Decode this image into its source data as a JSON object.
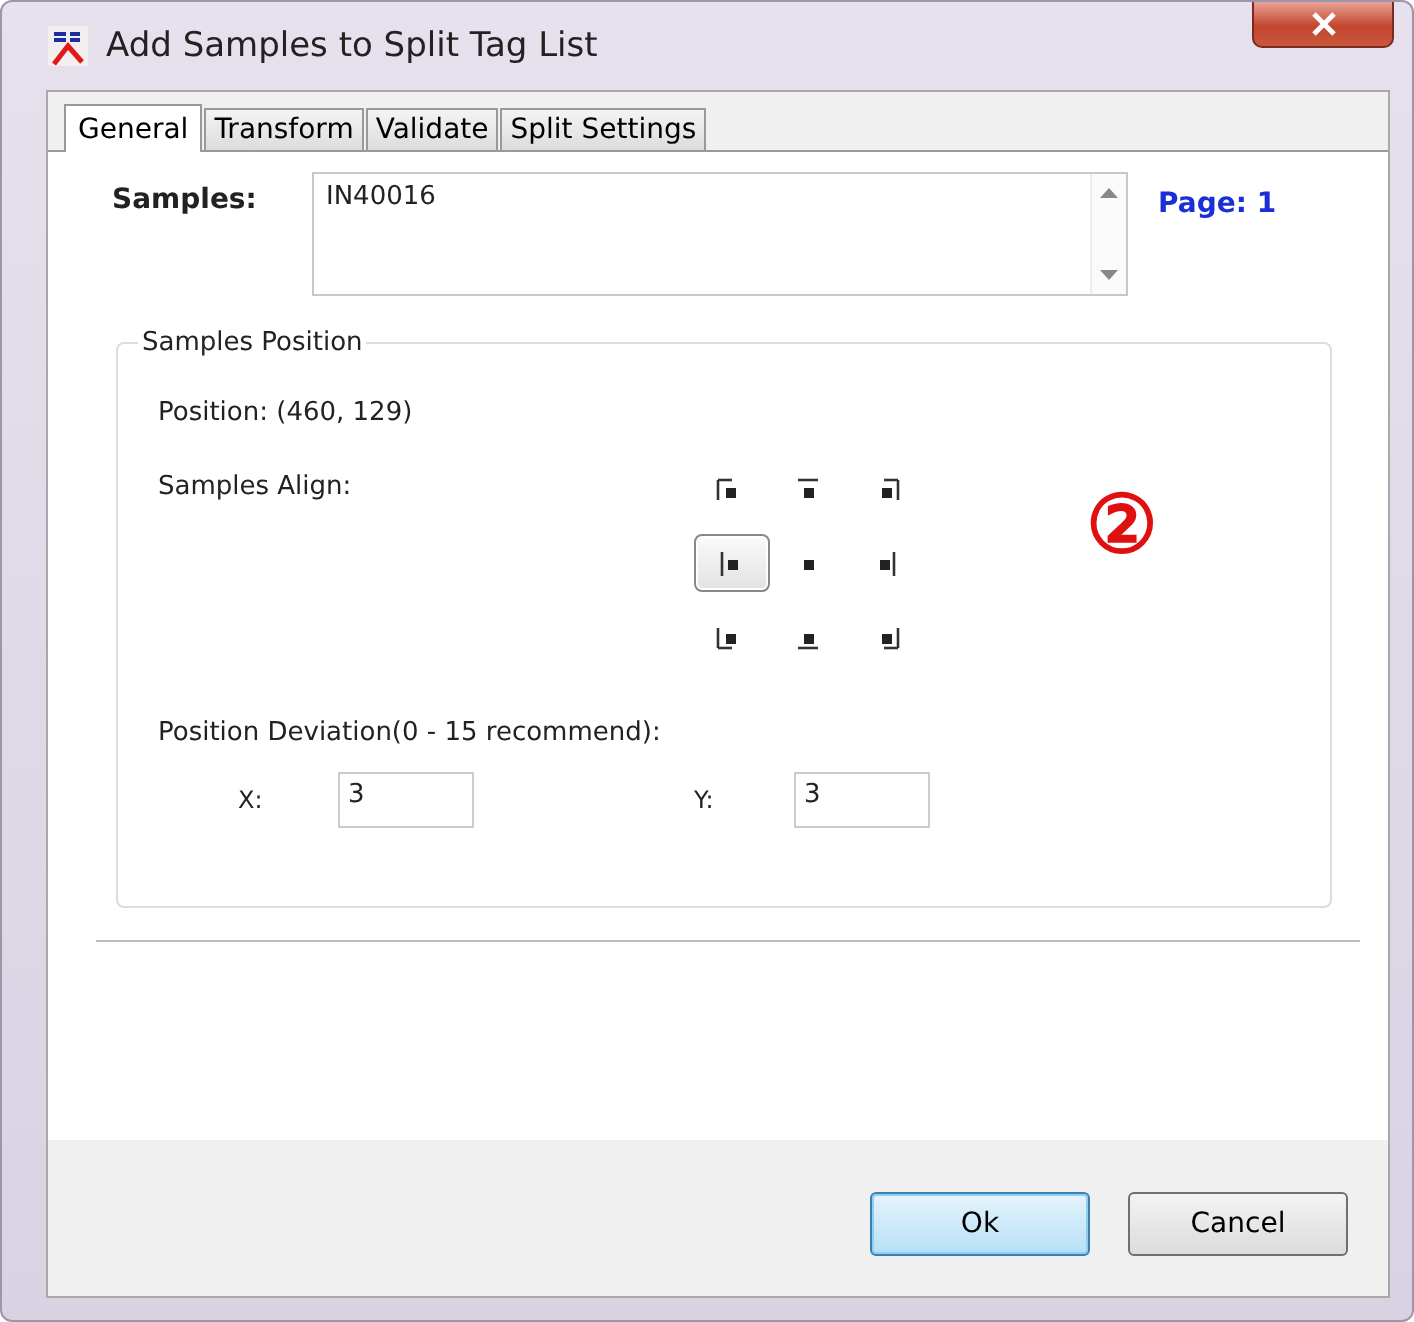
{
  "window": {
    "title": "Add Samples to Split Tag List"
  },
  "tabs": [
    {
      "label": "General",
      "selected": true
    },
    {
      "label": "Transform",
      "selected": false
    },
    {
      "label": "Validate",
      "selected": false
    },
    {
      "label": "Split Settings",
      "selected": false
    }
  ],
  "samples": {
    "label": "Samples:",
    "value": "IN40016",
    "page": "Page: 1"
  },
  "group": {
    "title": "Samples Position",
    "position": "Position: (460, 129)",
    "align_label": "Samples Align:",
    "align_options": [
      {
        "kind": "top-left",
        "selected": false
      },
      {
        "kind": "top",
        "selected": false
      },
      {
        "kind": "top-right",
        "selected": false
      },
      {
        "kind": "left",
        "selected": true
      },
      {
        "kind": "center",
        "selected": false
      },
      {
        "kind": "right",
        "selected": false
      },
      {
        "kind": "bottom-left",
        "selected": false
      },
      {
        "kind": "bottom",
        "selected": false
      },
      {
        "kind": "bottom-right",
        "selected": false
      }
    ],
    "deviation_label": "Position Deviation(0 - 15 recommend):",
    "x_label": "X:",
    "x_value": "3",
    "y_label": "Y:",
    "y_value": "3"
  },
  "annotation": "②",
  "buttons": [
    {
      "label": "Ok",
      "kind": "default"
    },
    {
      "label": "Cancel",
      "kind": "normal"
    }
  ]
}
